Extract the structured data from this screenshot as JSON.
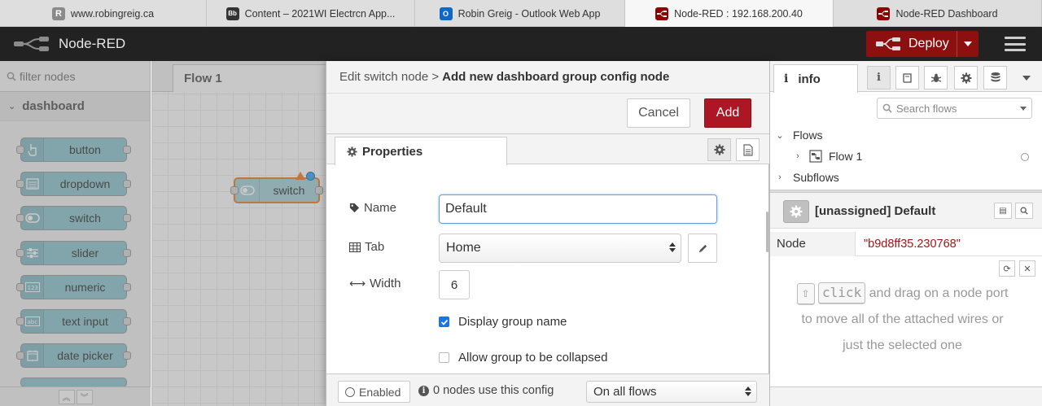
{
  "browser_tabs": [
    {
      "favicon": "R",
      "title": "www.robingreig.ca",
      "width": 254
    },
    {
      "favicon": "Bb",
      "title": "Content – 2021WI Electrcn App...",
      "width": 256
    },
    {
      "favicon": "O",
      "title": "Robin Greig - Outlook Web App",
      "width": 258
    },
    {
      "favicon": "NR",
      "title": "Node-RED : 192.168.200.40",
      "width": 256,
      "active": true
    },
    {
      "favicon": "NR",
      "title": "Node-RED Dashboard",
      "width": 256
    }
  ],
  "header": {
    "app_name": "Node-RED",
    "deploy_label": "Deploy"
  },
  "palette": {
    "filter_placeholder": "filter nodes",
    "category": "dashboard",
    "nodes": [
      {
        "label": "button",
        "icon": "hand-pointer-icon"
      },
      {
        "label": "dropdown",
        "icon": "list-icon"
      },
      {
        "label": "switch",
        "icon": "toggle-icon"
      },
      {
        "label": "slider",
        "icon": "sliders-icon"
      },
      {
        "label": "numeric",
        "icon": "numeric-icon"
      },
      {
        "label": "text input",
        "icon": "text-field-icon"
      },
      {
        "label": "date picker",
        "icon": "calendar-icon"
      }
    ]
  },
  "workspace": {
    "tab": "Flow 1",
    "node_label": "switch"
  },
  "tray": {
    "breadcrumb": "Edit switch node >",
    "title": "Add new dashboard group config node",
    "cancel_label": "Cancel",
    "add_label": "Add",
    "tab_label": "Properties",
    "fields": {
      "name_label": "Name",
      "name_value": "Default",
      "tab_label": "Tab",
      "tab_value": "Home",
      "width_label": "Width",
      "width_value": "6",
      "display_group_name": "Display group name",
      "display_group_name_checked": true,
      "allow_collapse": "Allow group to be collapsed",
      "allow_collapse_checked": false
    },
    "footer": {
      "enabled_label": "Enabled",
      "usage_text": "0 nodes use this config",
      "scope_value": "On all flows"
    }
  },
  "sidebar": {
    "tab_label": "info",
    "search_placeholder": "Search flows",
    "tree": {
      "flows_label": "Flows",
      "flow1_label": "Flow 1",
      "subflows_label": "Subflows"
    },
    "node_title": "[unassigned] Default",
    "prop_key": "Node",
    "prop_value": "\"b9d8ff35.230768\"",
    "tip": {
      "key_shift": "⇧",
      "key_click": "click",
      "line1_rest": "and drag on a node port",
      "line2": "to move all of the attached wires or",
      "line3": "just the selected one"
    }
  },
  "colors": {
    "header_bg": "#222222",
    "deploy_bg": "#8c1010",
    "add_button_bg": "#ad1625",
    "dashboard_node": "#8fc7d0",
    "selected_outline": "#f07d20",
    "property_value": "#a31515"
  }
}
